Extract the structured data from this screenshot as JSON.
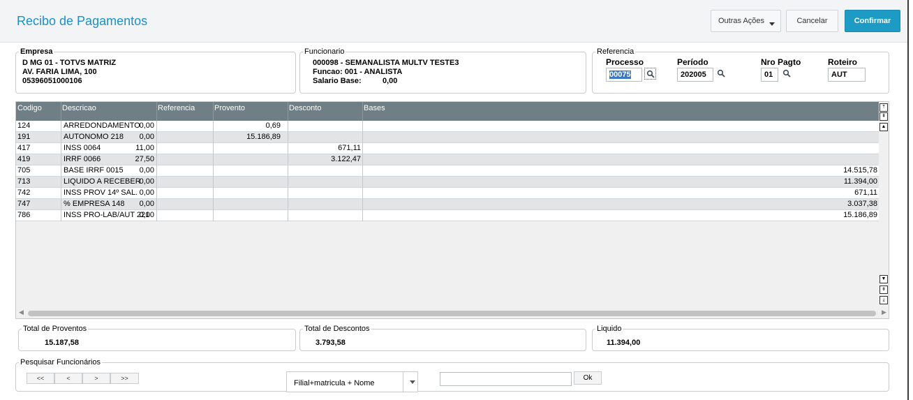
{
  "header": {
    "title": "Recibo de Pagamentos",
    "other_actions_label": "Outras Ações",
    "cancel_label": "Cancelar",
    "confirm_label": "Confirmar"
  },
  "empresa": {
    "legend": "Empresa",
    "line1": "D MG 01  - TOTVS MATRIZ",
    "line2": "AV. FARIA LIMA, 100",
    "line3": "05396051000106"
  },
  "funcionario": {
    "legend": "Funcionario",
    "line1": "000098 - SEMANALISTA MULTV TESTE3",
    "line2": "Funcao: 001   - ANALISTA",
    "salary_label": "Salario Base:",
    "salary_value": "0,00"
  },
  "referencia": {
    "legend": "Referencia",
    "processo_label": "Processo",
    "processo_value": "00075",
    "periodo_label": "Período",
    "periodo_value": "202005",
    "nro_pagto_label": "Nro Pagto",
    "nro_pagto_value": "01",
    "roteiro_label": "Roteiro",
    "roteiro_value": "AUT"
  },
  "grid": {
    "columns": [
      "Codigo",
      "Descricao",
      "Referencia",
      "Provento",
      "Desconto",
      "Bases"
    ],
    "rows": [
      {
        "codigo": "124",
        "descricao": "ARREDONDAMENTO",
        "referencia": "0,00",
        "provento": "0,69",
        "desconto": "",
        "bases": ""
      },
      {
        "codigo": "191",
        "descricao": "AUTONOMO 218",
        "referencia": "0,00",
        "provento": "15.186,89",
        "desconto": "",
        "bases": ""
      },
      {
        "codigo": "417",
        "descricao": "INSS 0064",
        "referencia": "11,00",
        "provento": "",
        "desconto": "671,11",
        "bases": ""
      },
      {
        "codigo": "419",
        "descricao": "IRRF 0066",
        "referencia": "27,50",
        "provento": "",
        "desconto": "3.122,47",
        "bases": ""
      },
      {
        "codigo": "705",
        "descricao": "BASE IRRF 0015",
        "referencia": "0,00",
        "provento": "",
        "desconto": "",
        "bases": "14.515,78"
      },
      {
        "codigo": "713",
        "descricao": "LIQUIDO A RECEBER",
        "referencia": "0,00",
        "provento": "",
        "desconto": "",
        "bases": "11.394,00"
      },
      {
        "codigo": "742",
        "descricao": "INSS PROV 14º SAL.",
        "referencia": "0,00",
        "provento": "",
        "desconto": "",
        "bases": "671,11"
      },
      {
        "codigo": "747",
        "descricao": "% EMPRESA  148",
        "referencia": "0,00",
        "provento": "",
        "desconto": "",
        "bases": "3.037,38"
      },
      {
        "codigo": "786",
        "descricao": "INSS PRO-LAB/AUT 221",
        "referencia": "0,00",
        "provento": "",
        "desconto": "",
        "bases": "15.186,89"
      }
    ]
  },
  "totals": {
    "proventos_label": "Total de Proventos",
    "proventos_value": "15.187,58",
    "descontos_label": "Total de Descontos",
    "descontos_value": "3.793,58",
    "liquido_label": "Liquido",
    "liquido_value": "11.394,00"
  },
  "search": {
    "legend": "Pesquisar Funcionários",
    "first_label": "<<",
    "prev_label": "<",
    "next_label": ">",
    "last_label": ">>",
    "order_value": "Filial+matricula + Nome",
    "search_value": "",
    "ok_label": "Ok"
  }
}
